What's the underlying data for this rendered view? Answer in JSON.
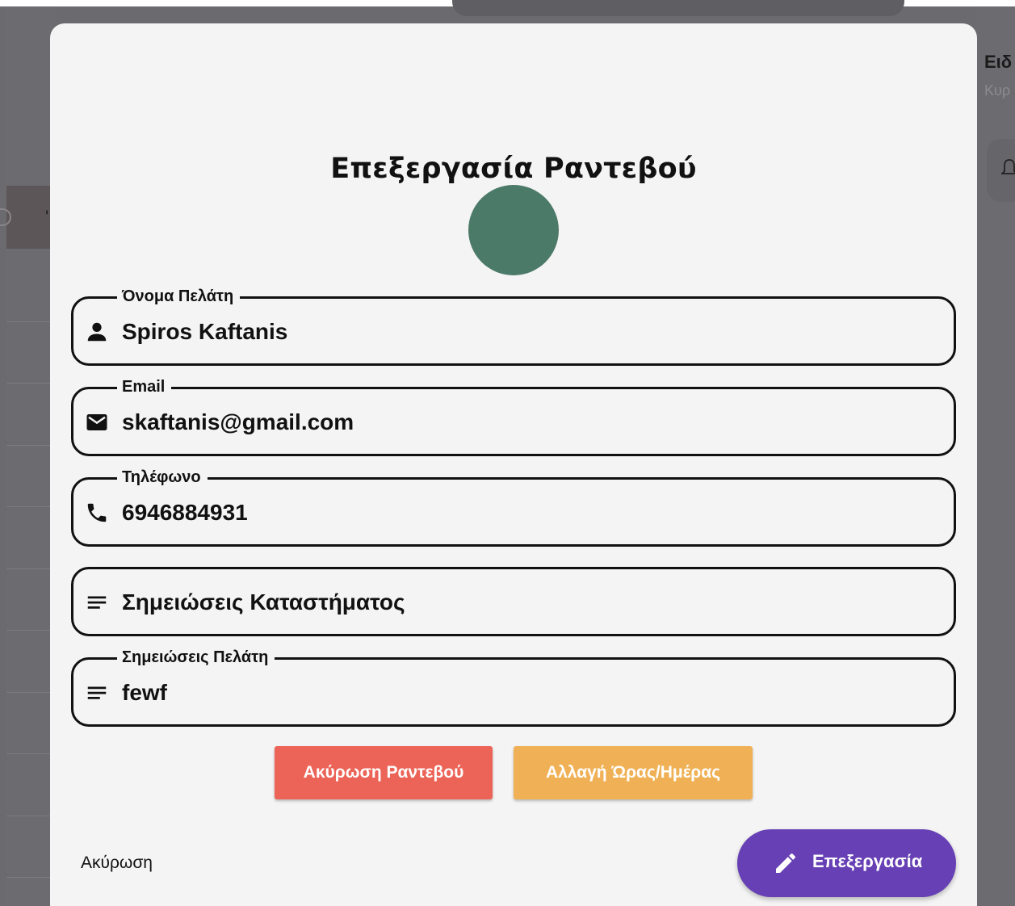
{
  "background": {
    "right_title": "Ειδ",
    "right_subtitle": "Κυρ",
    "table_mark": "'"
  },
  "modal": {
    "title": "Επεξεργασία Ραντεβού",
    "avatar_color": "#4c7a69",
    "fields": {
      "name": {
        "label": "Όνομα Πελάτη",
        "value": "Spiros Kaftanis",
        "icon": "person-icon"
      },
      "email": {
        "label": "Email",
        "value": "skaftanis@gmail.com",
        "icon": "mail-icon"
      },
      "phone": {
        "label": "Τηλέφωνο",
        "value": "6946884931",
        "icon": "phone-icon"
      },
      "store_notes": {
        "placeholder": "Σημειώσεις Καταστήματος",
        "icon": "notes-icon"
      },
      "customer_notes": {
        "label": "Σημειώσεις Πελάτη",
        "value": "fewf",
        "icon": "notes-icon"
      }
    },
    "buttons": {
      "cancel_appointment": "Ακύρωση Ραντεβού",
      "change_time": "Αλλαγή Ώρας/Ημέρας",
      "cancel": "Ακύρωση",
      "edit": "Επεξεργασία"
    },
    "colors": {
      "cancel_appointment": "#ec6458",
      "change_time": "#f0b156",
      "edit": "#6640b4"
    }
  }
}
